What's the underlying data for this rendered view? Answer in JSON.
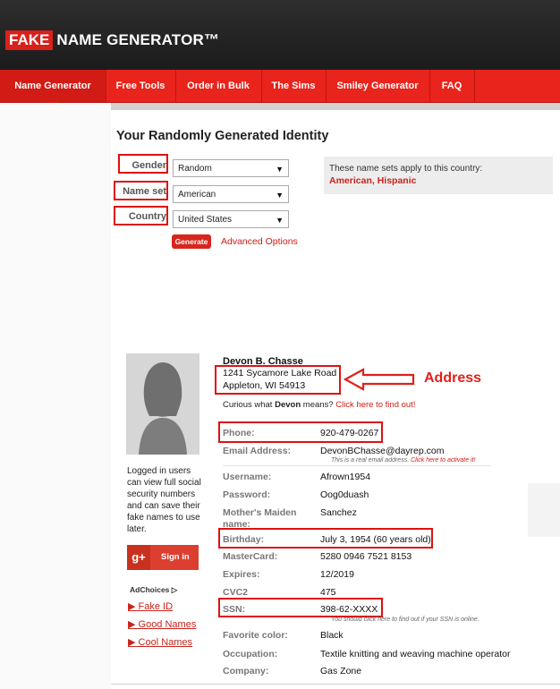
{
  "header": {
    "logo_fake": "FAKE",
    "logo_rest": "NAME GENERATOR™"
  },
  "nav": {
    "items": [
      {
        "label": "Name Generator"
      },
      {
        "label": "Free Tools"
      },
      {
        "label": "Order in Bulk"
      },
      {
        "label": "The Sims"
      },
      {
        "label": "Smiley Generator"
      },
      {
        "label": "FAQ"
      }
    ]
  },
  "page": {
    "title": "Your Randomly Generated Identity"
  },
  "form": {
    "gender_label": "Gender",
    "gender_value": "Random",
    "nameset_label": "Name set",
    "nameset_value": "American",
    "country_label": "Country",
    "country_value": "United States",
    "generate_label": "Generate",
    "advanced_label": "Advanced Options",
    "dropdown_arrow": "▼"
  },
  "info": {
    "text": "These name sets apply to this country:",
    "sets": "American, Hispanic"
  },
  "sidebar": {
    "login_text": "Logged in users can view full social security numbers and can save their fake names to use later.",
    "gplus_icon": "g+",
    "signin_label": "Sign in",
    "adchoices": "AdChoices ▷",
    "links": [
      {
        "label": "▶ Fake ID"
      },
      {
        "label": "▶ Good Names"
      },
      {
        "label": "▶ Cool Names"
      }
    ]
  },
  "identity": {
    "name": "Devon B. Chasse",
    "address_line1": "1241 Sycamore Lake Road",
    "address_line2": "Appleton, WI 54913",
    "curious_prefix": "Curious what ",
    "curious_name": "Devon",
    "curious_mid": " means? ",
    "curious_link": "Click here to find out!",
    "annotation": "Address",
    "fields": {
      "phone_k": "Phone:",
      "phone_v": "920-479-0267",
      "email_k": "Email Address:",
      "email_v": "DevonBChasse@dayrep.com",
      "email_note": "This is a real email address.",
      "email_note_link": "Click here to activate it!",
      "user_k": "Username:",
      "user_v": "Afrown1954",
      "pass_k": "Password:",
      "pass_v": "Oog0duash",
      "maiden_k1": "Mother's Maiden",
      "maiden_k2": "name:",
      "maiden_v": "Sanchez",
      "bday_k": "Birthday:",
      "bday_v": "July 3, 1954 (60 years old)",
      "mc_k": "MasterCard:",
      "mc_v": "5280 0946 7521 8153",
      "exp_k": "Expires:",
      "exp_v": "12/2019",
      "cvc_k": "CVC2",
      "cvc_v": "475",
      "ssn_k": "SSN:",
      "ssn_v": "398-62-XXXX",
      "ssn_note": "You should click here to find out if your SSN is online.",
      "color_k": "Favorite color:",
      "color_v": "Black",
      "occ_k": "Occupation:",
      "occ_v": "Textile knitting and weaving machine operator",
      "comp_k": "Company:",
      "comp_v": "Gas Zone"
    }
  },
  "colors": {
    "brand_red": "#e8241c",
    "header_dark": "#222222",
    "annotation_red": "#dd1111"
  }
}
